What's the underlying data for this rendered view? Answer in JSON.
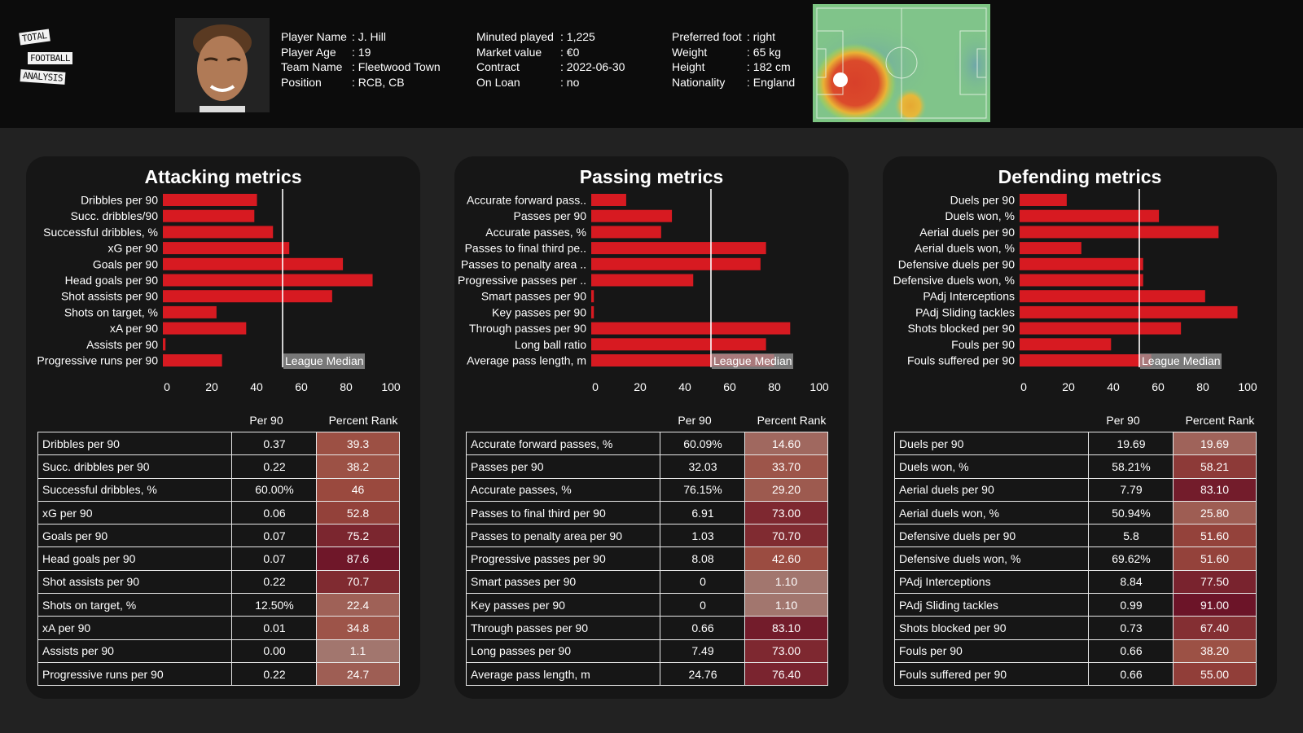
{
  "header": {
    "logo": {
      "lines": [
        "TOTAL",
        "FOOTBALL",
        "ANALYSIS"
      ]
    },
    "player_photo_alt": "player-photo",
    "info_col1": [
      {
        "key": "Player Name",
        "value": ": J. Hill"
      },
      {
        "key": "Player Age",
        "value": ": 19"
      },
      {
        "key": "Team Name",
        "value": ": Fleetwood Town"
      },
      {
        "key": "Position",
        "value": ": RCB, CB"
      }
    ],
    "info_col2": [
      {
        "key": "Minuted played",
        "value": ": 1,225"
      },
      {
        "key": "Market value",
        "value": ": €0"
      },
      {
        "key": "Contract",
        "value": ": 2022-06-30"
      },
      {
        "key": "On Loan",
        "value": ": no"
      }
    ],
    "info_col3": [
      {
        "key": "Preferred foot",
        "value": ": right"
      },
      {
        "key": "Weight",
        "value": ": 65 kg"
      },
      {
        "key": "Height",
        "value": ": 182 cm"
      },
      {
        "key": "Nationality",
        "value": ": England"
      }
    ]
  },
  "colors": {
    "bar": "#d71a21",
    "median_line": "#ffffff",
    "median_label_bg": "#9a9a9a",
    "rank_low": "#a2776f",
    "rank_mid": "#9b4a3e",
    "rank_high": "#6c1428"
  },
  "tables_header": {
    "per90": "Per 90",
    "rank": "Percent Rank"
  },
  "chart_data": [
    {
      "type": "bar",
      "orientation": "horizontal",
      "title": "Attacking metrics",
      "categories": [
        "Dribbles per 90",
        "Succ. dribbles/90",
        "Successful dribbles, %",
        "xG per 90",
        "Goals per 90",
        "Head goals per 90",
        "Shot assists per 90",
        "Shots on target, %",
        "xA per 90",
        "Assists per 90",
        "Progressive runs per 90"
      ],
      "values": [
        39.3,
        38.2,
        46,
        52.8,
        75.2,
        87.6,
        70.7,
        22.4,
        34.8,
        1.1,
        24.7
      ],
      "xlim": [
        0,
        100
      ],
      "xticks": [
        "0",
        "20",
        "40",
        "60",
        "80",
        "100"
      ],
      "reference_line": {
        "value": 50,
        "label": "League Median"
      },
      "table": {
        "rows": [
          {
            "name": "Dribbles per 90",
            "per90": "0.37",
            "rank": "39.3"
          },
          {
            "name": "Succ. dribbles per 90",
            "per90": "0.22",
            "rank": "38.2"
          },
          {
            "name": "Successful dribbles, %",
            "per90": "60.00%",
            "rank": "46"
          },
          {
            "name": "xG per 90",
            "per90": "0.06",
            "rank": "52.8"
          },
          {
            "name": "Goals per 90",
            "per90": "0.07",
            "rank": "75.2"
          },
          {
            "name": "Head goals per 90",
            "per90": "0.07",
            "rank": "87.6"
          },
          {
            "name": "Shot assists per 90",
            "per90": "0.22",
            "rank": "70.7"
          },
          {
            "name": "Shots on target, %",
            "per90": "12.50%",
            "rank": "22.4"
          },
          {
            "name": "xA per 90",
            "per90": "0.01",
            "rank": "34.8"
          },
          {
            "name": "Assists per 90",
            "per90": "0.00",
            "rank": "1.1"
          },
          {
            "name": "Progressive runs per 90",
            "per90": "0.22",
            "rank": "24.7"
          }
        ]
      }
    },
    {
      "type": "bar",
      "orientation": "horizontal",
      "title": "Passing metrics",
      "categories": [
        "Accurate forward pass..",
        "Passes per 90",
        "Accurate passes, %",
        "Passes to final third pe..",
        "Passes to penalty area ..",
        "Progressive passes per ..",
        "Smart passes per 90",
        "Key passes per 90",
        "Through passes per 90",
        "Long ball ratio",
        "Average pass length, m"
      ],
      "values": [
        14.6,
        33.7,
        29.2,
        73.0,
        70.7,
        42.6,
        1.1,
        1.1,
        83.1,
        73.0,
        76.4
      ],
      "xlim": [
        0,
        100
      ],
      "xticks": [
        "0",
        "20",
        "40",
        "60",
        "80",
        "100"
      ],
      "reference_line": {
        "value": 50,
        "label": "League Median"
      },
      "table": {
        "rows": [
          {
            "name": "Accurate forward passes, %",
            "per90": "60.09%",
            "rank": "14.60"
          },
          {
            "name": "Passes per 90",
            "per90": "32.03",
            "rank": "33.70"
          },
          {
            "name": "Accurate passes, %",
            "per90": "76.15%",
            "rank": "29.20"
          },
          {
            "name": "Passes to final third per 90",
            "per90": "6.91",
            "rank": "73.00"
          },
          {
            "name": "Passes to penalty area per 90",
            "per90": "1.03",
            "rank": "70.70"
          },
          {
            "name": "Progressive passes per 90",
            "per90": "8.08",
            "rank": "42.60"
          },
          {
            "name": "Smart passes per 90",
            "per90": "0",
            "rank": "1.10"
          },
          {
            "name": "Key passes per 90",
            "per90": "0",
            "rank": "1.10"
          },
          {
            "name": "Through passes per 90",
            "per90": "0.66",
            "rank": "83.10"
          },
          {
            "name": "Long passes per 90",
            "per90": "7.49",
            "rank": "73.00"
          },
          {
            "name": "Average pass length, m",
            "per90": "24.76",
            "rank": "76.40"
          }
        ]
      }
    },
    {
      "type": "bar",
      "orientation": "horizontal",
      "title": "Defending metrics",
      "categories": [
        "Duels per 90",
        "Duels won, %",
        "Aerial duels per 90",
        "Aerial duels won, %",
        "Defensive duels per 90",
        "Defensive duels won, %",
        "PAdj Interceptions",
        "PAdj Sliding tackles",
        "Shots blocked per 90",
        "Fouls per 90",
        "Fouls suffered per 90"
      ],
      "values": [
        19.69,
        58.21,
        83.1,
        25.8,
        51.6,
        51.6,
        77.5,
        91.0,
        67.4,
        38.2,
        55.0
      ],
      "xlim": [
        0,
        100
      ],
      "xticks": [
        "0",
        "20",
        "40",
        "60",
        "80",
        "100"
      ],
      "reference_line": {
        "value": 50,
        "label": "League Median"
      },
      "table": {
        "rows": [
          {
            "name": "Duels per 90",
            "per90": "19.69",
            "rank": "19.69"
          },
          {
            "name": "Duels won, %",
            "per90": "58.21%",
            "rank": "58.21"
          },
          {
            "name": "Aerial duels per 90",
            "per90": "7.79",
            "rank": "83.10"
          },
          {
            "name": "Aerial duels won, %",
            "per90": "50.94%",
            "rank": "25.80"
          },
          {
            "name": "Defensive duels per 90",
            "per90": "5.8",
            "rank": "51.60"
          },
          {
            "name": "Defensive duels won, %",
            "per90": "69.62%",
            "rank": "51.60"
          },
          {
            "name": "PAdj Interceptions",
            "per90": "8.84",
            "rank": "77.50"
          },
          {
            "name": "PAdj Sliding tackles",
            "per90": "0.99",
            "rank": "91.00"
          },
          {
            "name": "Shots blocked per 90",
            "per90": "0.73",
            "rank": "67.40"
          },
          {
            "name": "Fouls per 90",
            "per90": "0.66",
            "rank": "38.20"
          },
          {
            "name": "Fouls suffered per 90",
            "per90": "0.66",
            "rank": "55.00"
          }
        ]
      }
    }
  ]
}
